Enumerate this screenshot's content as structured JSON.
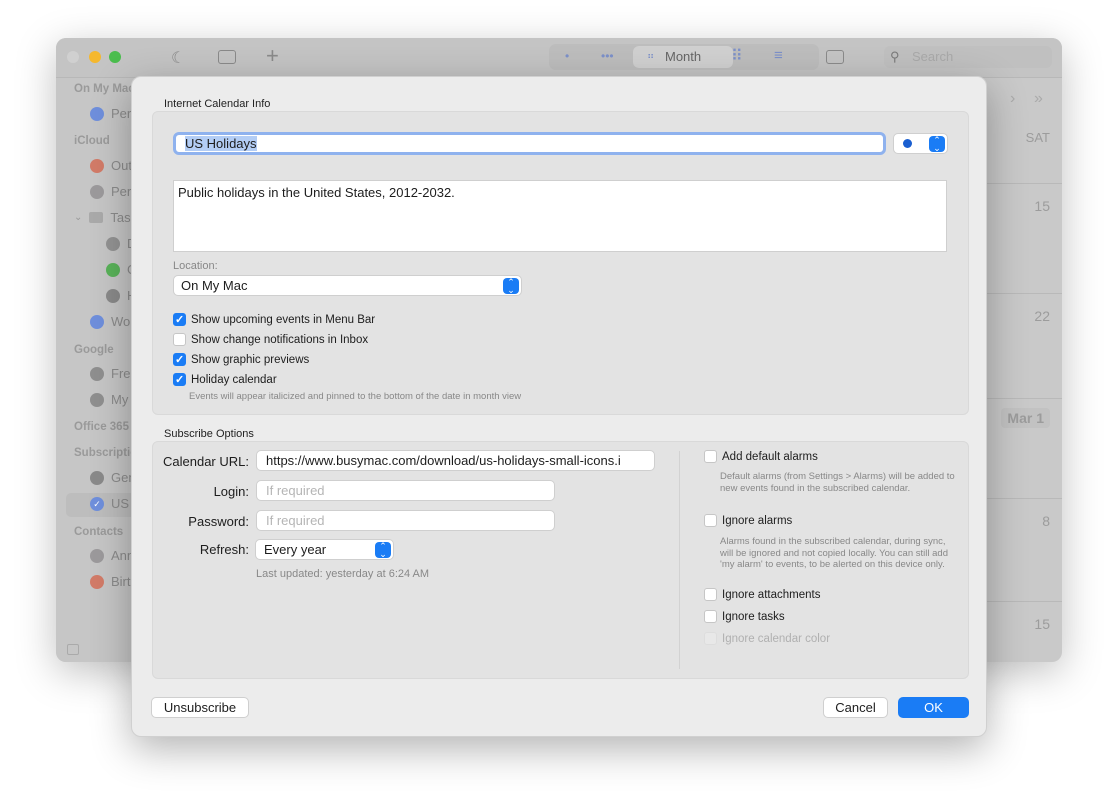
{
  "toolbar": {
    "view_label": "Month",
    "search_placeholder": "Search",
    "traffic_colors": [
      "#d0d0d0",
      "#f5b82e",
      "#4bbd4e"
    ]
  },
  "sidebar": {
    "items": [
      {
        "type": "header",
        "label": "On My Mac"
      },
      {
        "type": "item",
        "label": "Pers",
        "color": "#6f8fdc",
        "indent": 0
      },
      {
        "type": "header",
        "label": "iCloud"
      },
      {
        "type": "item",
        "label": "Out",
        "color": "#d27b68",
        "indent": 0
      },
      {
        "type": "item",
        "label": "Pers",
        "color": "#9c9a9c",
        "indent": 0
      },
      {
        "type": "folder",
        "label": "Tasl",
        "indent": 0
      },
      {
        "type": "item",
        "label": "D",
        "color": "#939393",
        "indent": 1
      },
      {
        "type": "item",
        "label": "G",
        "color": "#5ab35a",
        "indent": 1
      },
      {
        "type": "item",
        "label": "H",
        "color": "#8a8a8a",
        "indent": 1
      },
      {
        "type": "item",
        "label": "Wor",
        "color": "#6f8fdc",
        "indent": 0
      },
      {
        "type": "header",
        "label": "Google"
      },
      {
        "type": "item",
        "label": "Free",
        "color": "#8f8f8f",
        "indent": 0
      },
      {
        "type": "item",
        "label": "My",
        "color": "#8f8f8f",
        "indent": 0
      },
      {
        "type": "header",
        "label": "Office 365"
      },
      {
        "type": "header",
        "label": "Subscriptio"
      },
      {
        "type": "item",
        "label": "Gen",
        "color": "#8a8a8a",
        "indent": 0
      },
      {
        "type": "item",
        "label": "US",
        "color": "#6f8fdc",
        "indent": 0,
        "checked": true,
        "selected": true
      },
      {
        "type": "header",
        "label": "Contacts"
      },
      {
        "type": "item",
        "label": "Ann",
        "color": "#9c9a9c",
        "indent": 0
      },
      {
        "type": "item",
        "label": "Birt",
        "color": "#d27b68",
        "indent": 0
      }
    ]
  },
  "calendar": {
    "day_header": "SAT",
    "dates": [
      "15",
      "22",
      "Mar 1",
      "8",
      "15"
    ]
  },
  "dialog": {
    "info_title": "Internet Calendar Info",
    "name": "US Holidays",
    "calendar_color": "#1a5fd0",
    "description": "Public holidays in the United States, 2012-2032.",
    "location_label": "Location:",
    "location_value": "On My Mac",
    "options": [
      {
        "label": "Show upcoming events in Menu Bar",
        "checked": true
      },
      {
        "label": "Show change notifications in Inbox",
        "checked": false
      },
      {
        "label": "Show graphic previews",
        "checked": true
      },
      {
        "label": "Holiday calendar",
        "checked": true
      }
    ],
    "holiday_note": "Events will appear italicized and pinned to the bottom of the date in month view",
    "subscribe_title": "Subscribe Options",
    "url_label": "Calendar URL:",
    "url_value": "https://www.busymac.com/download/us-holidays-small-icons.i",
    "login_label": "Login:",
    "login_placeholder": "If required",
    "password_label": "Password:",
    "password_placeholder": "If required",
    "refresh_label": "Refresh:",
    "refresh_value": "Every year",
    "last_updated": "Last updated: yesterday at 6:24 AM",
    "right_options": [
      {
        "label": "Add default alarms",
        "checked": false,
        "note": "Default alarms (from Settings > Alarms) will be added to new events found in the subscribed calendar."
      },
      {
        "label": "Ignore alarms",
        "checked": false,
        "note": "Alarms found in the subscribed calendar, during sync, will be ignored and not copied locally. You can still add 'my alarm' to events, to be alerted on this device only."
      },
      {
        "label": "Ignore attachments",
        "checked": false
      },
      {
        "label": "Ignore tasks",
        "checked": false
      },
      {
        "label": "Ignore calendar color",
        "checked": false,
        "disabled": true
      }
    ],
    "unsubscribe": "Unsubscribe",
    "cancel": "Cancel",
    "ok": "OK",
    "accent": "#1a7cf5"
  }
}
